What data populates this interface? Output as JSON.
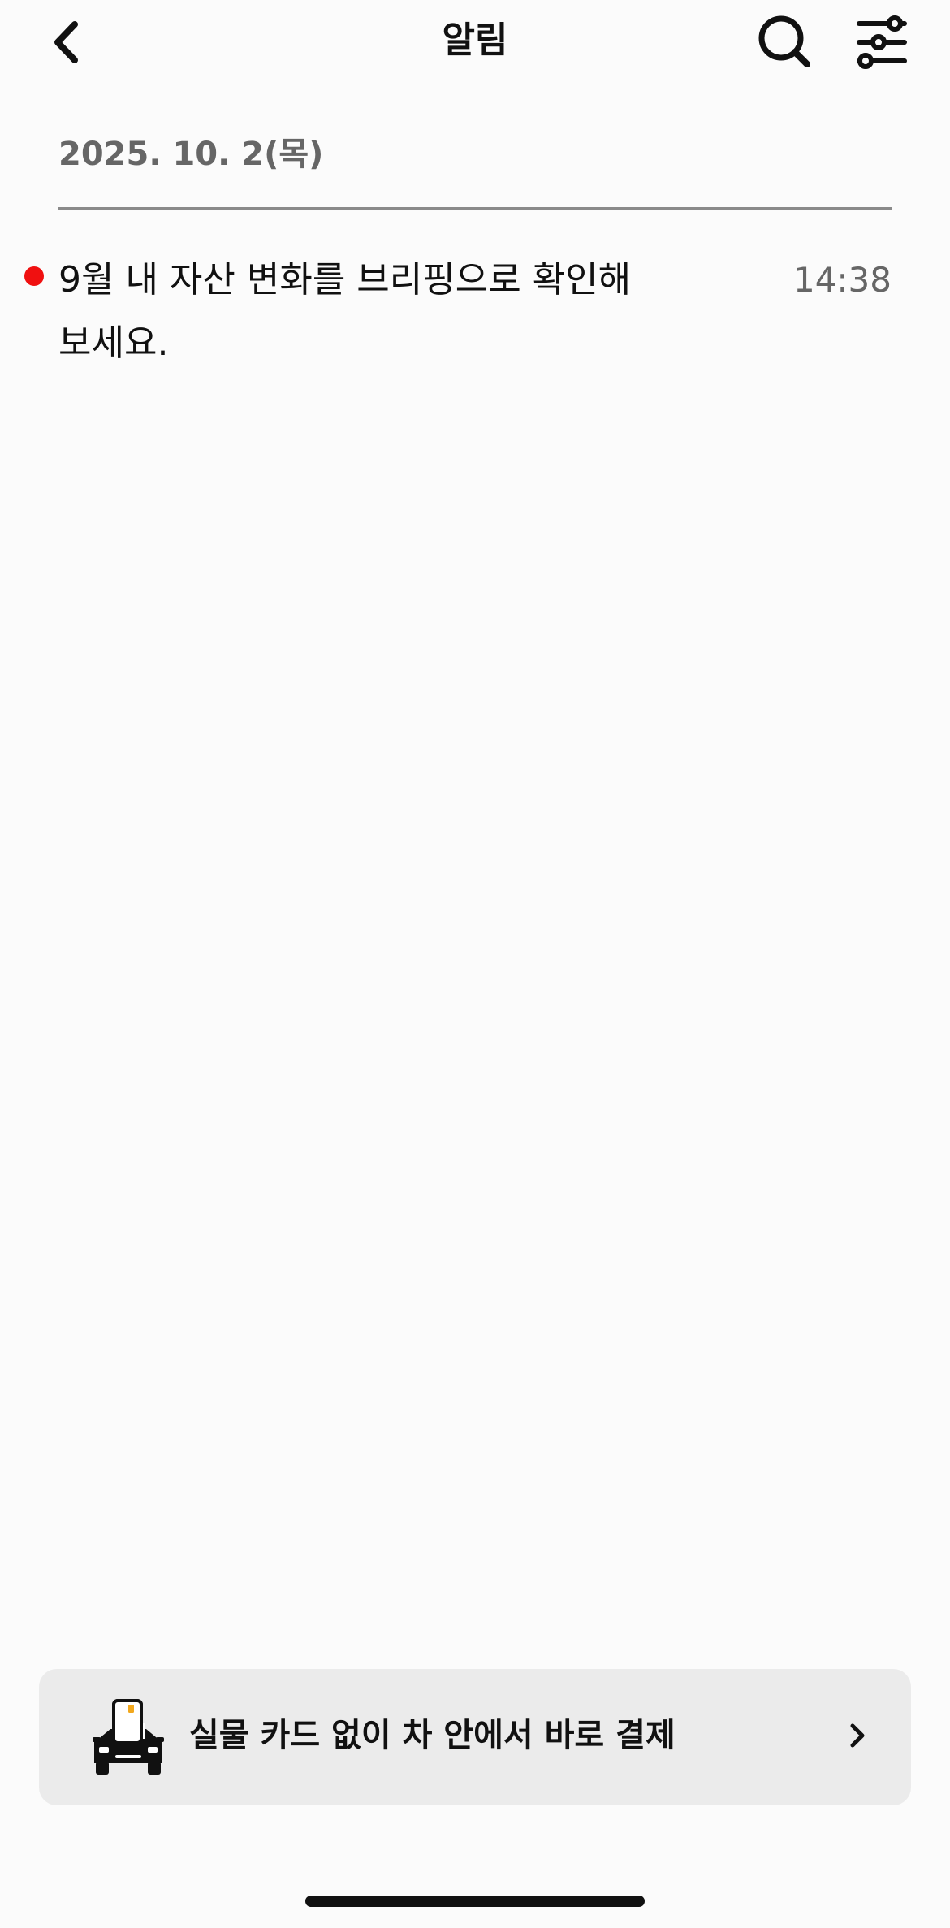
{
  "header": {
    "title": "알림",
    "back_icon": "chevron-left-icon",
    "search_icon": "search-icon",
    "filter_icon": "sliders-icon"
  },
  "notifications": {
    "groups": [
      {
        "date": "2025. 10. 2(목)",
        "items": [
          {
            "message": "9월 내 자산 변화를 브리핑으로 확인해 보세요.",
            "time": "14:38",
            "unread": true
          }
        ]
      }
    ]
  },
  "banner": {
    "text": "실물 카드 없이 차 안에서 바로 결제",
    "icon": "car-card-icon",
    "chevron_icon": "chevron-right-icon"
  },
  "colors": {
    "unread_dot": "#f01010",
    "secondary_text": "#666666",
    "banner_bg": "#ebebeb",
    "card_chip": "#f2a81d"
  }
}
